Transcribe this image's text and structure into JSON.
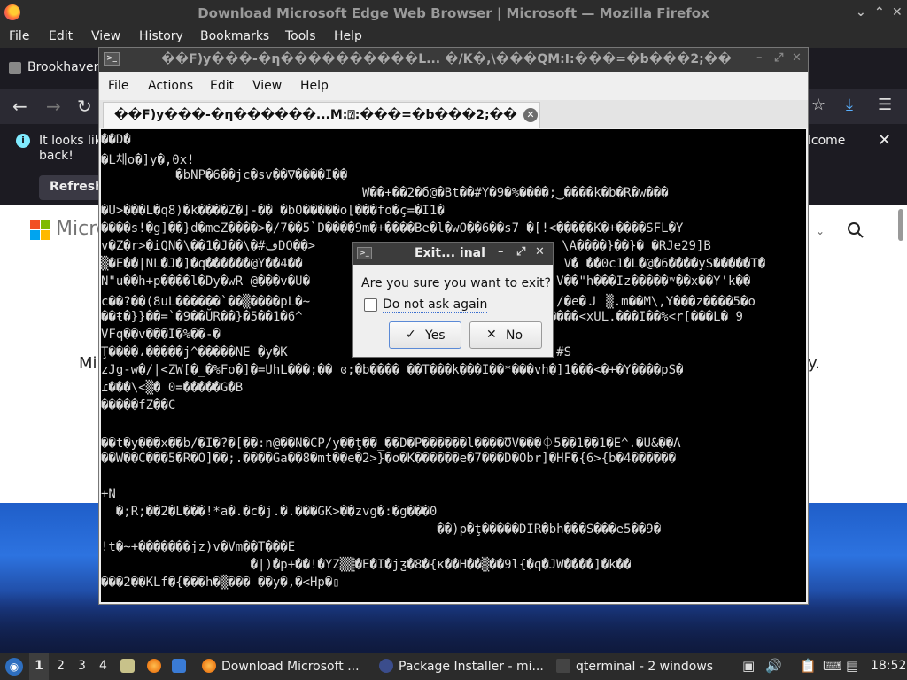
{
  "firefox": {
    "window_title": "Download Microsoft Edge Web Browser | Microsoft — Mozilla Firefox",
    "menu": [
      "File",
      "Edit",
      "View",
      "History",
      "Bookmarks",
      "Tools",
      "Help"
    ],
    "tab_label": "Brookhaven",
    "notification": {
      "line1": "It looks lik",
      "line2": "back!",
      "refresh_label": "Refresh",
      "right_text": "lcome",
      "close_label": "✕"
    },
    "page": {
      "brand": "Micro",
      "side_left": "Mi",
      "side_right": "y."
    },
    "icons": {
      "back": "←",
      "forward": "→",
      "reload": "↻",
      "bookmark_star": "☆",
      "download": "⤓",
      "menu": "☰"
    }
  },
  "terminal": {
    "window_title": "��F)y���-�η����������L...    �/K�,\\���QM:ⵏ:���=�b���2;��",
    "menu": [
      "File",
      "Actions",
      "Edit",
      "View",
      "Help"
    ],
    "tab_label": "��F)y���-�η������...M:⍰:���=�b���2;��",
    "tab_close": "✕",
    "lines": [
      "��D�",
      "�L체o�]y�,0x!",
      "          �bNP�6��jc�sv��∇����I��",
      "                                   W��+��2�б@�Bt��#Y�9�%����;‿����k�b�R�w���",
      "�U>���L�q8)�k����Z�]-�� �bO�����o[���fo�ç=�I1�",
      "����s!�g]��}d�meZ����>�/7��5`D����9m�+����Be�l�wO��6��s7 �[!<�����K�+����SFL�Y",
      "v�Z�r>�iQN�\\��1�J��\\�#ڡDO��>                                 \\A����}��}� �RJe29]B",
      "▒�E��|NL�J�]�q������@Y��4��                                   V� ��0c1�L�@�6����yS�����T�",
      "N\"u��h+p����l�Dy�wR @���v�U�                                 V��\"h���Iz�����ʷ��x��Y'k��",
      "c��?��(8uL������`��▒����pL�~                                 /�e�Ｊ ▒.m��M\\,Y���z����5�o",
      "��ŧ�}}��=`�9��ŬR��}�5��1�6^                                 ����<xUL.���I��%<r[���L� 9",
      "VFq��v���I�%��-�",
      "Ţ����،�����j^�����NE �y�K                                    #S",
      "zJg-w�/|<ZW[�_�%Fo�]�=UhL���;�� ɞ;�b���� ��T���k���I��*���vh�]1���<�+�Y����pS�",
      "ɾ���\\<▒� 0=�����G�B",
      "�����fZ��C",
      "",
      "��t�y���x��b/�I�?�[��:n@��N�CP/y��ƫ��_��D�P������l����ƱV���⏀5��1��1�E^.�U&��Λ",
      "��W��C���5�R�O]��;.����Ga��8�mt��e�2>}�o�K������e�7���D�Obr]�HF�{6>{b�4������",
      "",
      "+N",
      "  �;R;��2�L���!*a�.�c�j.�.���GK>��zvg�:�g���0",
      "                                             ��)p�ţ�����DIR�bh���S���e5��9�",
      "!t�~+�������jz)v�Vm��T���E",
      "                    �|)�p+��!�YZ▒▒�E�I�jƺ�8�{ĸ��H��▒��9l{�q�JW����]�k��",
      "���2��KLf�{���h�▒��� ��y�,�<Hp�▯"
    ]
  },
  "dialog": {
    "title": "Exit... inal",
    "question": "Are you sure you want to exit?",
    "checkbox_label": "Do not ask again",
    "checkbox_checked": false,
    "yes_label": "Yes",
    "no_label": "No",
    "yes_glyph": "✓",
    "no_glyph": "✕"
  },
  "taskbar": {
    "workspaces": [
      "1",
      "2",
      "3",
      "4"
    ],
    "active_workspace": "1",
    "tasks": [
      {
        "label": "Download Microsoft ...",
        "icon": "firefox-icon"
      },
      {
        "label": "Package Installer - mi...",
        "icon": "package-installer-icon"
      },
      {
        "label": "qterminal - 2 windows",
        "icon": "terminal-icon"
      }
    ],
    "clock": "18:52"
  }
}
